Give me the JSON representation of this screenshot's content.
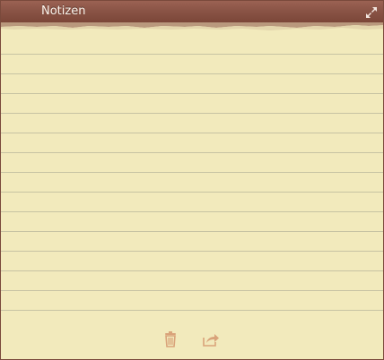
{
  "window": {
    "title": "Notizen"
  },
  "note": {
    "content": ""
  },
  "toolbar": {
    "buttons": [
      {
        "icon": "trash-icon"
      },
      {
        "icon": "share-icon"
      }
    ]
  },
  "colors": {
    "titlebar": "#8a5446",
    "paper": "#f2eabc",
    "rule_line": "#c7c3a3",
    "icon_tint": "#d9a37a"
  }
}
